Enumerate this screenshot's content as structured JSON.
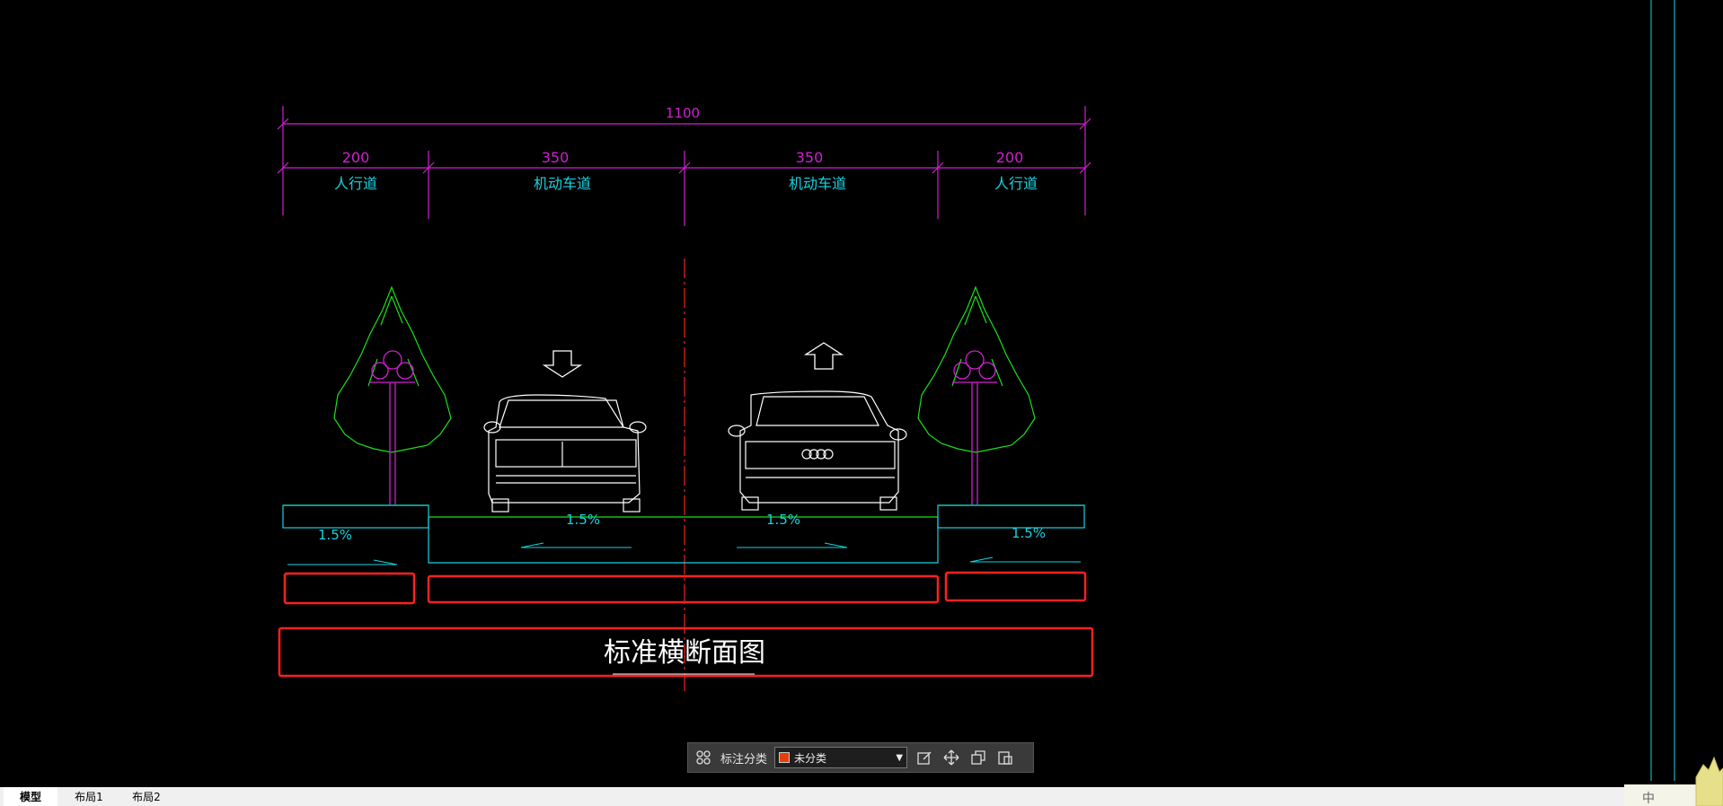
{
  "drawing": {
    "overall_width": "1100",
    "sections": [
      {
        "width": "200",
        "label": "人行道"
      },
      {
        "width": "350",
        "label": "机动车道"
      },
      {
        "width": "350",
        "label": "机动车道"
      },
      {
        "width": "200",
        "label": "人行道"
      }
    ],
    "slopes": [
      "1.5%",
      "1.5%",
      "1.5%",
      "1.5%"
    ],
    "title": "标准横断面图",
    "colors": {
      "dimension": "#d21fd2",
      "label": "#19d2e0",
      "tree": "#19e019",
      "road": "#19d2e0",
      "highlight": "#ff2020",
      "white": "#ffffff"
    }
  },
  "toolbar": {
    "label": "标注分类",
    "select_value": "未分类",
    "swatch_color": "#e0400a",
    "icons": [
      "grid-icon",
      "edit-icon",
      "move-icon",
      "copy-icon",
      "paste-icon"
    ]
  },
  "tabs": [
    "模型",
    "布局1",
    "布局2"
  ],
  "status_hint": "中"
}
